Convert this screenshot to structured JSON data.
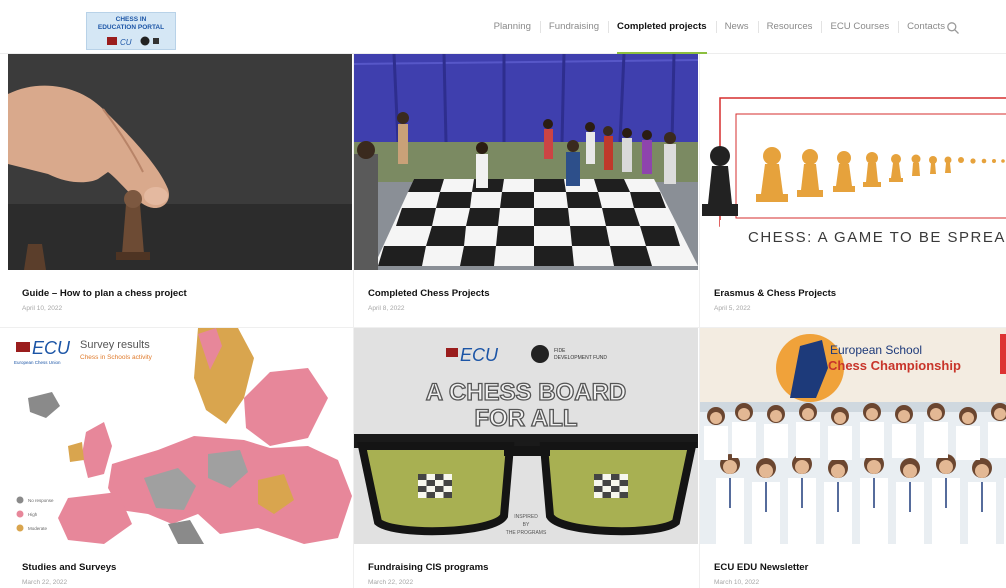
{
  "header": {
    "logo": {
      "title_line1": "CHESS IN",
      "title_line2": "EDUCATION PORTAL"
    },
    "nav": [
      {
        "label": "Planning",
        "active": false
      },
      {
        "label": "Fundraising",
        "active": false
      },
      {
        "label": "Completed projects",
        "active": true
      },
      {
        "label": "News",
        "active": false
      },
      {
        "label": "Resources",
        "active": false
      },
      {
        "label": "ECU Courses",
        "active": false
      },
      {
        "label": "Contacts",
        "active": false
      }
    ],
    "accent_color": "#8cbf3f"
  },
  "cards": [
    {
      "title": "Guide – How to plan a chess project",
      "date": "April 10, 2022",
      "image": "hand-moving-chess-piece"
    },
    {
      "title": "Completed Chess Projects",
      "date": "April 8, 2022",
      "image": "children-on-giant-chessboard"
    },
    {
      "title": "Erasmus & Chess Projects",
      "date": "April 5, 2022",
      "image": "row-of-pawns"
    },
    {
      "title": "Studies and Surveys",
      "date": "March 22, 2022",
      "image": "europe-survey-map"
    },
    {
      "title": "Fundraising CIS programs",
      "date": "March 22, 2022",
      "image": "chess-board-for-all-poster"
    },
    {
      "title": "ECU EDU Newsletter",
      "date": "March 10, 2022",
      "image": "school-championship-group-photo"
    }
  ],
  "images": {
    "erasmus_caption": "CHESS: A GAME TO BE SPREAD IN SCHO",
    "survey": {
      "brand": "ECU",
      "brand_sub": "European Chess Union",
      "title": "Survey results",
      "subtitle": "Chess in Schools activity",
      "legend": [
        "No response",
        "High",
        "Moderate"
      ]
    },
    "fundraising": {
      "brand": "ECU",
      "fund_line1": "FIDE",
      "fund_line2": "DEVELOPMENT FUND",
      "headline1": "A CHESS BOARD",
      "headline2": "FOR ALL",
      "inspired1": "INSPIRED",
      "inspired2": "BY",
      "inspired3": "THE PROGRAMS"
    },
    "championship": {
      "line1": "European School",
      "line2": "Chess Championship"
    }
  }
}
